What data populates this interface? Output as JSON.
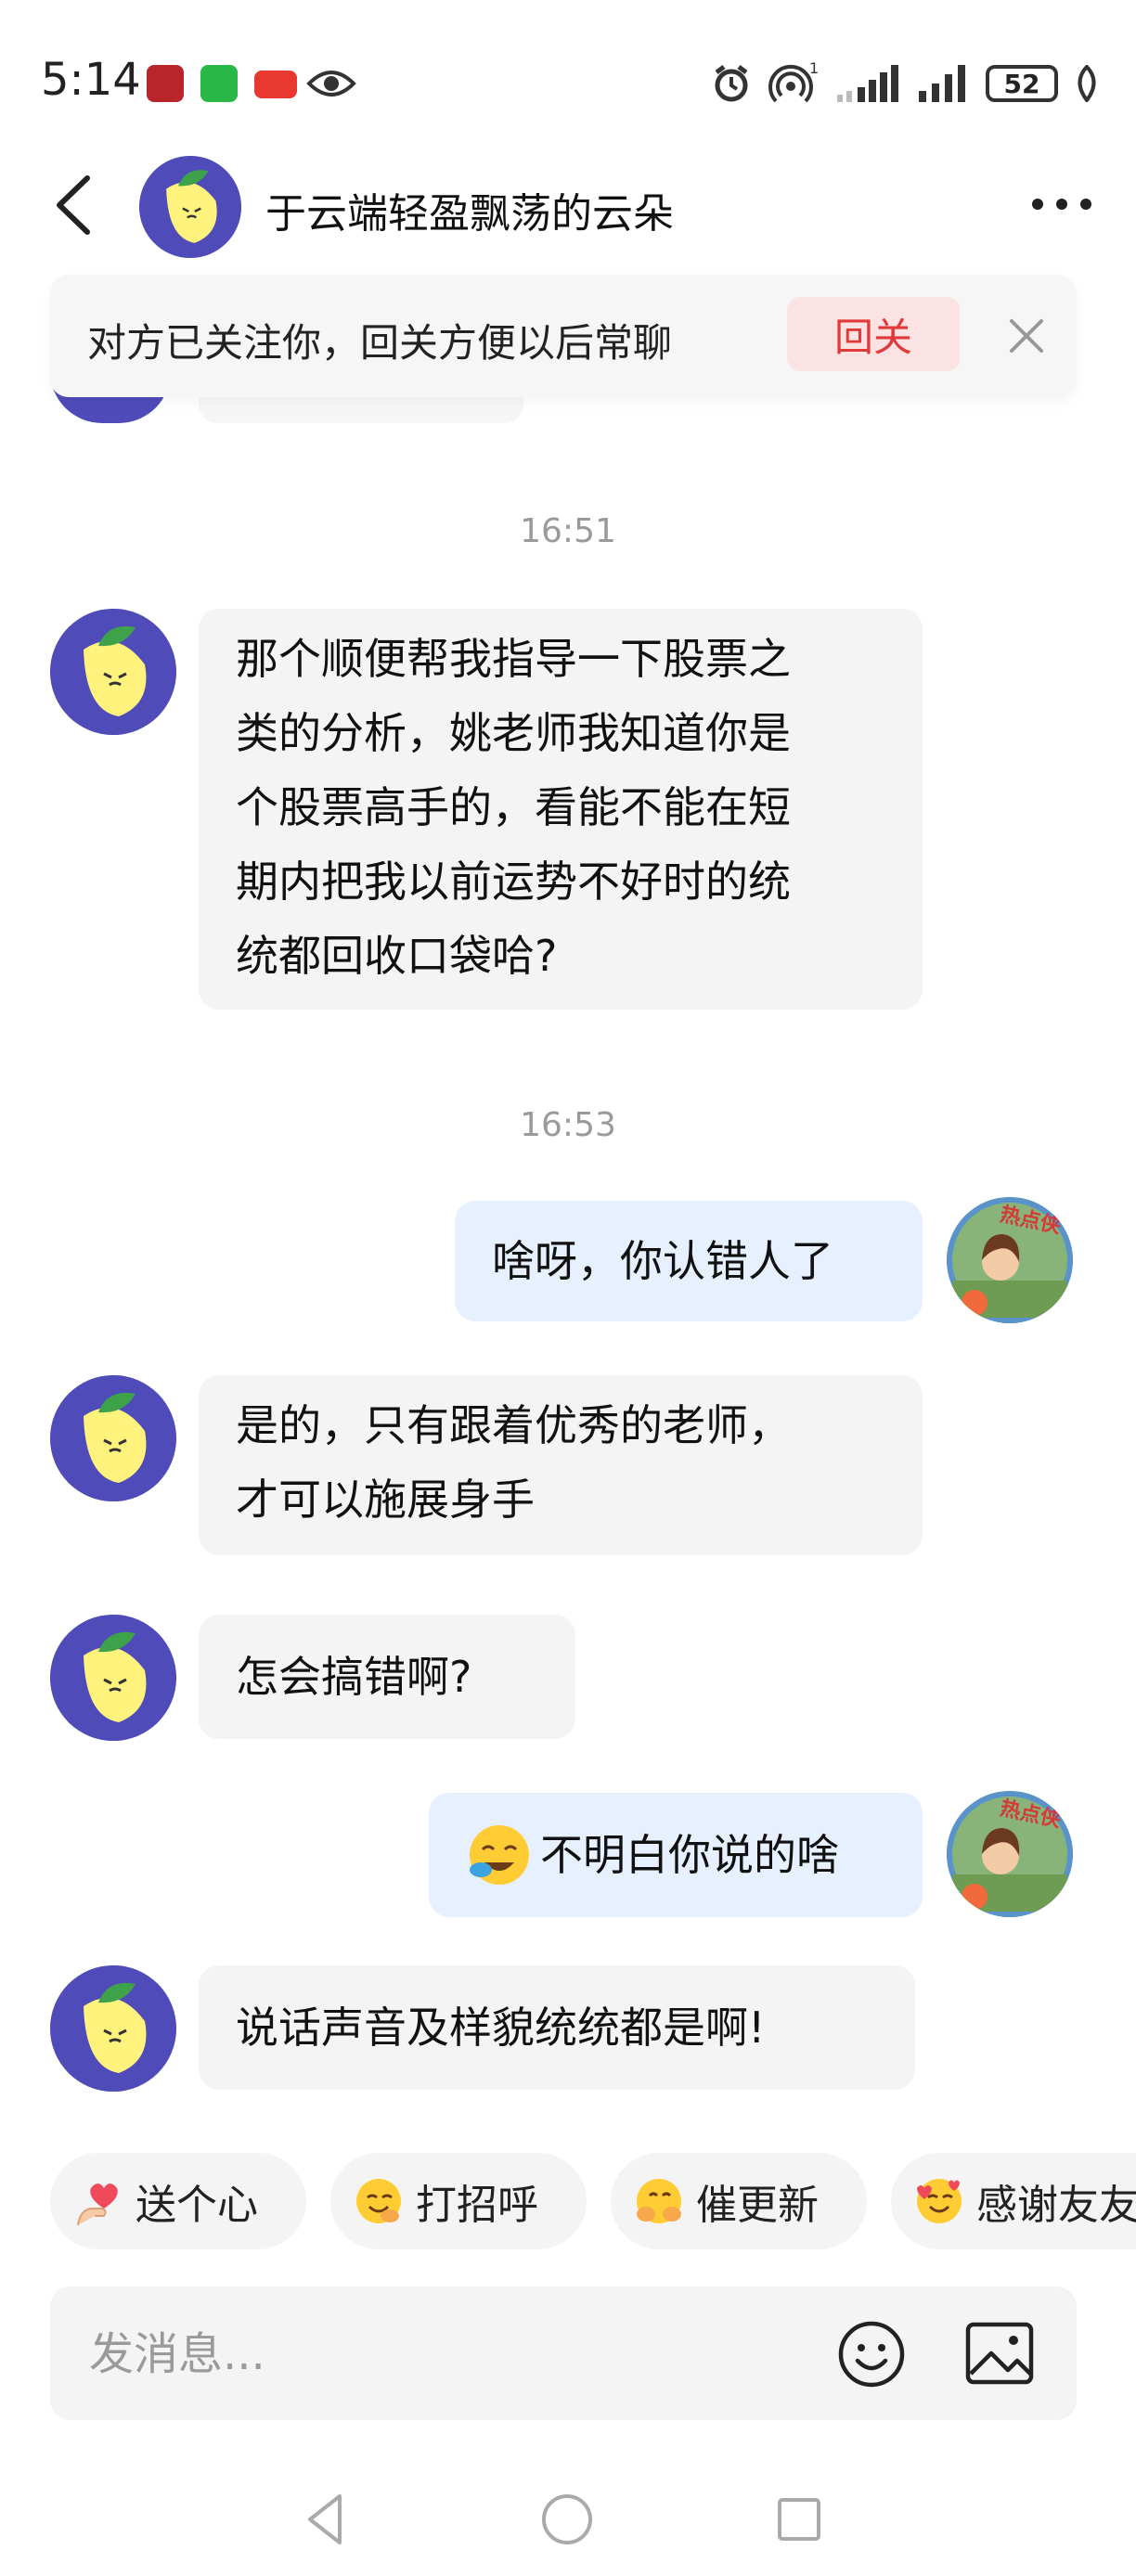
{
  "status_bar": {
    "time": "5:14",
    "battery": "52",
    "signal_sup": "1"
  },
  "header": {
    "title": "于云端轻盈飘荡的云朵"
  },
  "banner": {
    "text": "对方已关注你，回关方便以后常聊",
    "follow_back_label": "回关"
  },
  "messages": [
    {
      "type": "time",
      "text": "16:51"
    },
    {
      "type": "left",
      "lines": [
        "那个顺便帮我指导一下股票之",
        "类的分析，姚老师我知道你是",
        "个股票高手的，看能不能在短",
        "期内把我以前运势不好时的统",
        "统都回收口袋哈?"
      ]
    },
    {
      "type": "time",
      "text": "16:53"
    },
    {
      "type": "right",
      "text": "啥呀，你认错人了"
    },
    {
      "type": "left",
      "lines": [
        "是的，只有跟着优秀的老师，",
        "才可以施展身手"
      ]
    },
    {
      "type": "left",
      "text": "怎会搞错啊?"
    },
    {
      "type": "right",
      "text": "不明白你说的啥",
      "emoji": "face-with-hand-over-mouth"
    },
    {
      "type": "left",
      "text": "说话声音及样貌统统都是啊!"
    }
  ],
  "self_avatar_badge": "热点侠",
  "quick_replies": [
    {
      "label": "送个心",
      "emoji": "heart-hand"
    },
    {
      "label": "打招呼",
      "emoji": "smiling-face"
    },
    {
      "label": "催更新",
      "emoji": "hugging-face"
    },
    {
      "label": "感谢友友",
      "emoji": "smiling-hearts-face"
    }
  ],
  "input": {
    "placeholder": "发消息..."
  },
  "colors": {
    "accent_red": "#e03a3a",
    "bubble_self": "#e6f0fe",
    "bubble_other": "#f4f4f4",
    "avatar_purple": "#4f4bb9"
  }
}
